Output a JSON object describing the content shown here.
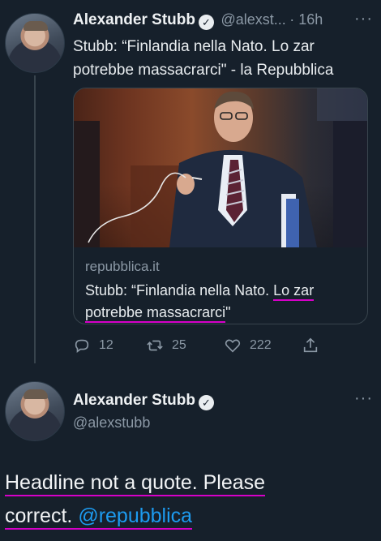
{
  "tweet": {
    "author_name": "Alexander Stubb",
    "handle": "@alexst...",
    "time": "16h",
    "text_line1": "Stubb: “Finlandia nella Nato. Lo zar",
    "text_line2": "potrebbe massacrarci\" - la Repubblica",
    "card": {
      "domain": "repubblica.it",
      "title_part1": "Stubb: “Finlandia nella Nato.",
      "title_part2": "Lo zar",
      "title_part3": "potrebbe massacrarci",
      "title_part4": "\""
    },
    "actions": {
      "replies": "12",
      "retweets": "25",
      "likes": "222"
    }
  },
  "reply": {
    "author_name": "Alexander Stubb",
    "handle": "@alexstubb",
    "text_part1": "Headline not a quote. Please",
    "text_part2": "correct.",
    "mention": "@repubblica"
  },
  "colors": {
    "background": "#16202b",
    "link": "#1d9bf0",
    "annotation_underline": "#d600c8",
    "muted": "#8b98a5"
  }
}
